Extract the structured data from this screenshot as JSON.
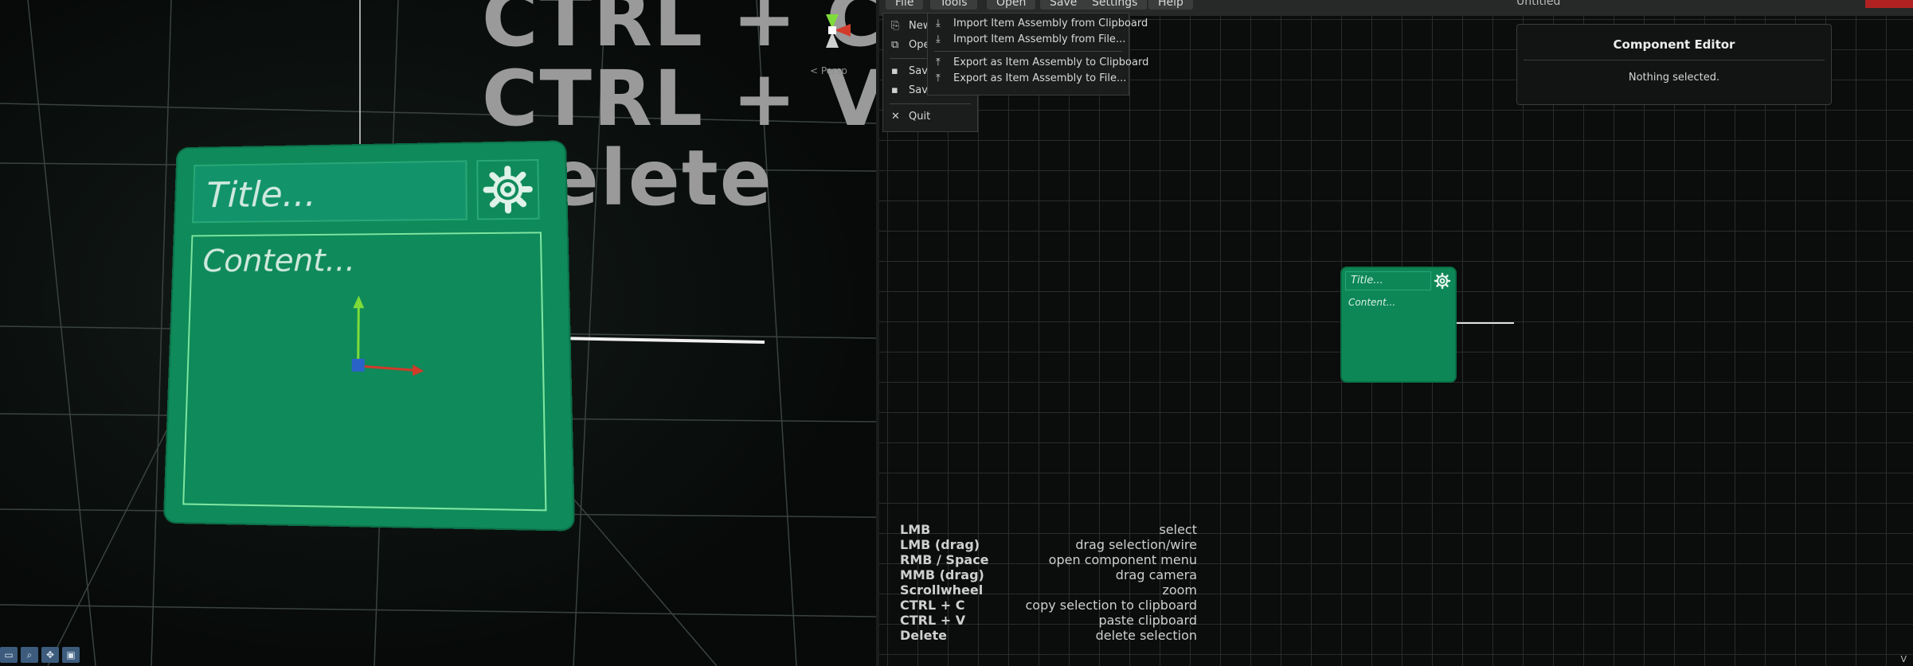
{
  "viewport3d": {
    "bg_words": [
      "CTRL + C",
      "CTRL + V",
      "Delete"
    ],
    "card": {
      "title_placeholder": "Title...",
      "content_placeholder": "Content..."
    },
    "gizmo_label": "< Persp",
    "toolbar_icons": [
      "select-icon",
      "zoom-icon",
      "move-icon",
      "camera-icon"
    ]
  },
  "menubar": {
    "buttons": [
      "File",
      "Tools",
      "Open",
      "Save",
      "Settings",
      "Help"
    ],
    "document_title": "Untitled",
    "quit_label": "Quit"
  },
  "file_menu": {
    "items": [
      {
        "icon": "new-file-icon",
        "label": "New"
      },
      {
        "icon": "open-icon",
        "label": "Open"
      },
      {
        "icon": "save-icon",
        "label": "Save"
      },
      {
        "icon": "save-as-icon",
        "label": "Save As"
      },
      {
        "icon": "close-icon",
        "label": "Quit"
      }
    ]
  },
  "submenu": {
    "items": [
      {
        "icon": "import-icon",
        "label": "Import Item Assembly from Clipboard"
      },
      {
        "icon": "import-icon",
        "label": "Import Item Assembly from File..."
      },
      {
        "icon": "export-icon",
        "label": "Export as Item Assembly to Clipboard"
      },
      {
        "icon": "export-icon",
        "label": "Export as Item Assembly to File..."
      }
    ]
  },
  "component_editor": {
    "title": "Component Editor",
    "message": "Nothing selected."
  },
  "node": {
    "title_placeholder": "Title...",
    "content_placeholder": "Content..."
  },
  "help": [
    {
      "key": "LMB",
      "action": "select"
    },
    {
      "key": "LMB (drag)",
      "action": "drag selection/wire"
    },
    {
      "key": "RMB / Space",
      "action": "open component menu"
    },
    {
      "key": "MMB (drag)",
      "action": "drag camera"
    },
    {
      "key": "Scrollwheel",
      "action": "zoom"
    },
    {
      "key": "CTRL + C",
      "action": "copy selection to clipboard"
    },
    {
      "key": "CTRL + V",
      "action": "paste clipboard"
    },
    {
      "key": "Delete",
      "action": "delete selection"
    }
  ],
  "corner_glyph": "V",
  "colors": {
    "node_green": "#0e8756",
    "danger": "#b02222",
    "grid": "#2a2d2c"
  }
}
